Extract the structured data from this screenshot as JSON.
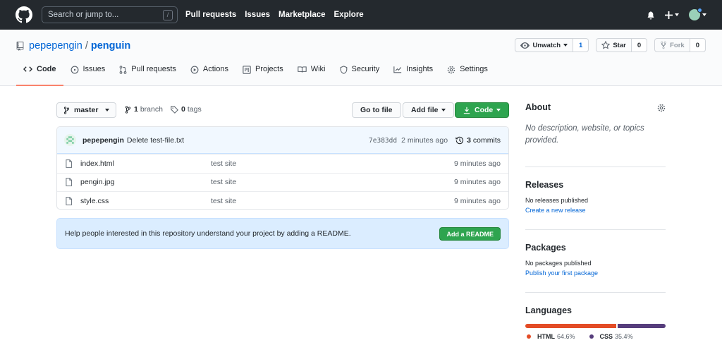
{
  "header": {
    "search_placeholder": "Search or jump to...",
    "search_shortcut": "/",
    "nav": [
      "Pull requests",
      "Issues",
      "Marketplace",
      "Explore"
    ]
  },
  "repo": {
    "owner": "pepepengin",
    "slash": "/",
    "name": "penguin",
    "watch_label": "Unwatch",
    "watch_count": "1",
    "star_label": "Star",
    "star_count": "0",
    "fork_label": "Fork",
    "fork_count": "0"
  },
  "tabs": [
    {
      "label": "Code",
      "icon": "code-icon",
      "active": true
    },
    {
      "label": "Issues",
      "icon": "issue-icon"
    },
    {
      "label": "Pull requests",
      "icon": "pull-request-icon"
    },
    {
      "label": "Actions",
      "icon": "play-icon"
    },
    {
      "label": "Projects",
      "icon": "project-icon"
    },
    {
      "label": "Wiki",
      "icon": "book-icon"
    },
    {
      "label": "Security",
      "icon": "shield-icon"
    },
    {
      "label": "Insights",
      "icon": "graph-icon"
    },
    {
      "label": "Settings",
      "icon": "gear-icon"
    }
  ],
  "file_nav": {
    "branch": "master",
    "branch_count": "1",
    "branch_label": "branch",
    "tag_count": "0",
    "tag_label": "tags",
    "go_to_file": "Go to file",
    "add_file": "Add file",
    "code": "Code"
  },
  "commit": {
    "author": "pepepengin",
    "message": "Delete test-file.txt",
    "sha": "7e383dd",
    "time": "2 minutes ago",
    "count": "3",
    "count_label": "commits"
  },
  "files": [
    {
      "name": "index.html",
      "message": "test site",
      "age": "9 minutes ago"
    },
    {
      "name": "pengin.jpg",
      "message": "test site",
      "age": "9 minutes ago"
    },
    {
      "name": "style.css",
      "message": "test site",
      "age": "9 minutes ago"
    }
  ],
  "readme": {
    "text": "Help people interested in this repository understand your project by adding a README.",
    "button": "Add a README"
  },
  "sidebar": {
    "about_title": "About",
    "about_desc": "No description, website, or topics provided.",
    "releases_title": "Releases",
    "releases_note": "No releases published",
    "releases_link": "Create a new release",
    "packages_title": "Packages",
    "packages_note": "No packages published",
    "packages_link": "Publish your first package",
    "languages_title": "Languages",
    "languages": [
      {
        "name": "HTML",
        "percent": "64.6%",
        "value": 64.6,
        "color": "#e34c26"
      },
      {
        "name": "CSS",
        "percent": "35.4%",
        "value": 35.4,
        "color": "#563d7c"
      }
    ]
  },
  "colors": {
    "header_bg": "#24292e",
    "accent_blue": "#0366d6",
    "primary_green": "#2ea44f",
    "tab_underline": "#f9826c"
  }
}
